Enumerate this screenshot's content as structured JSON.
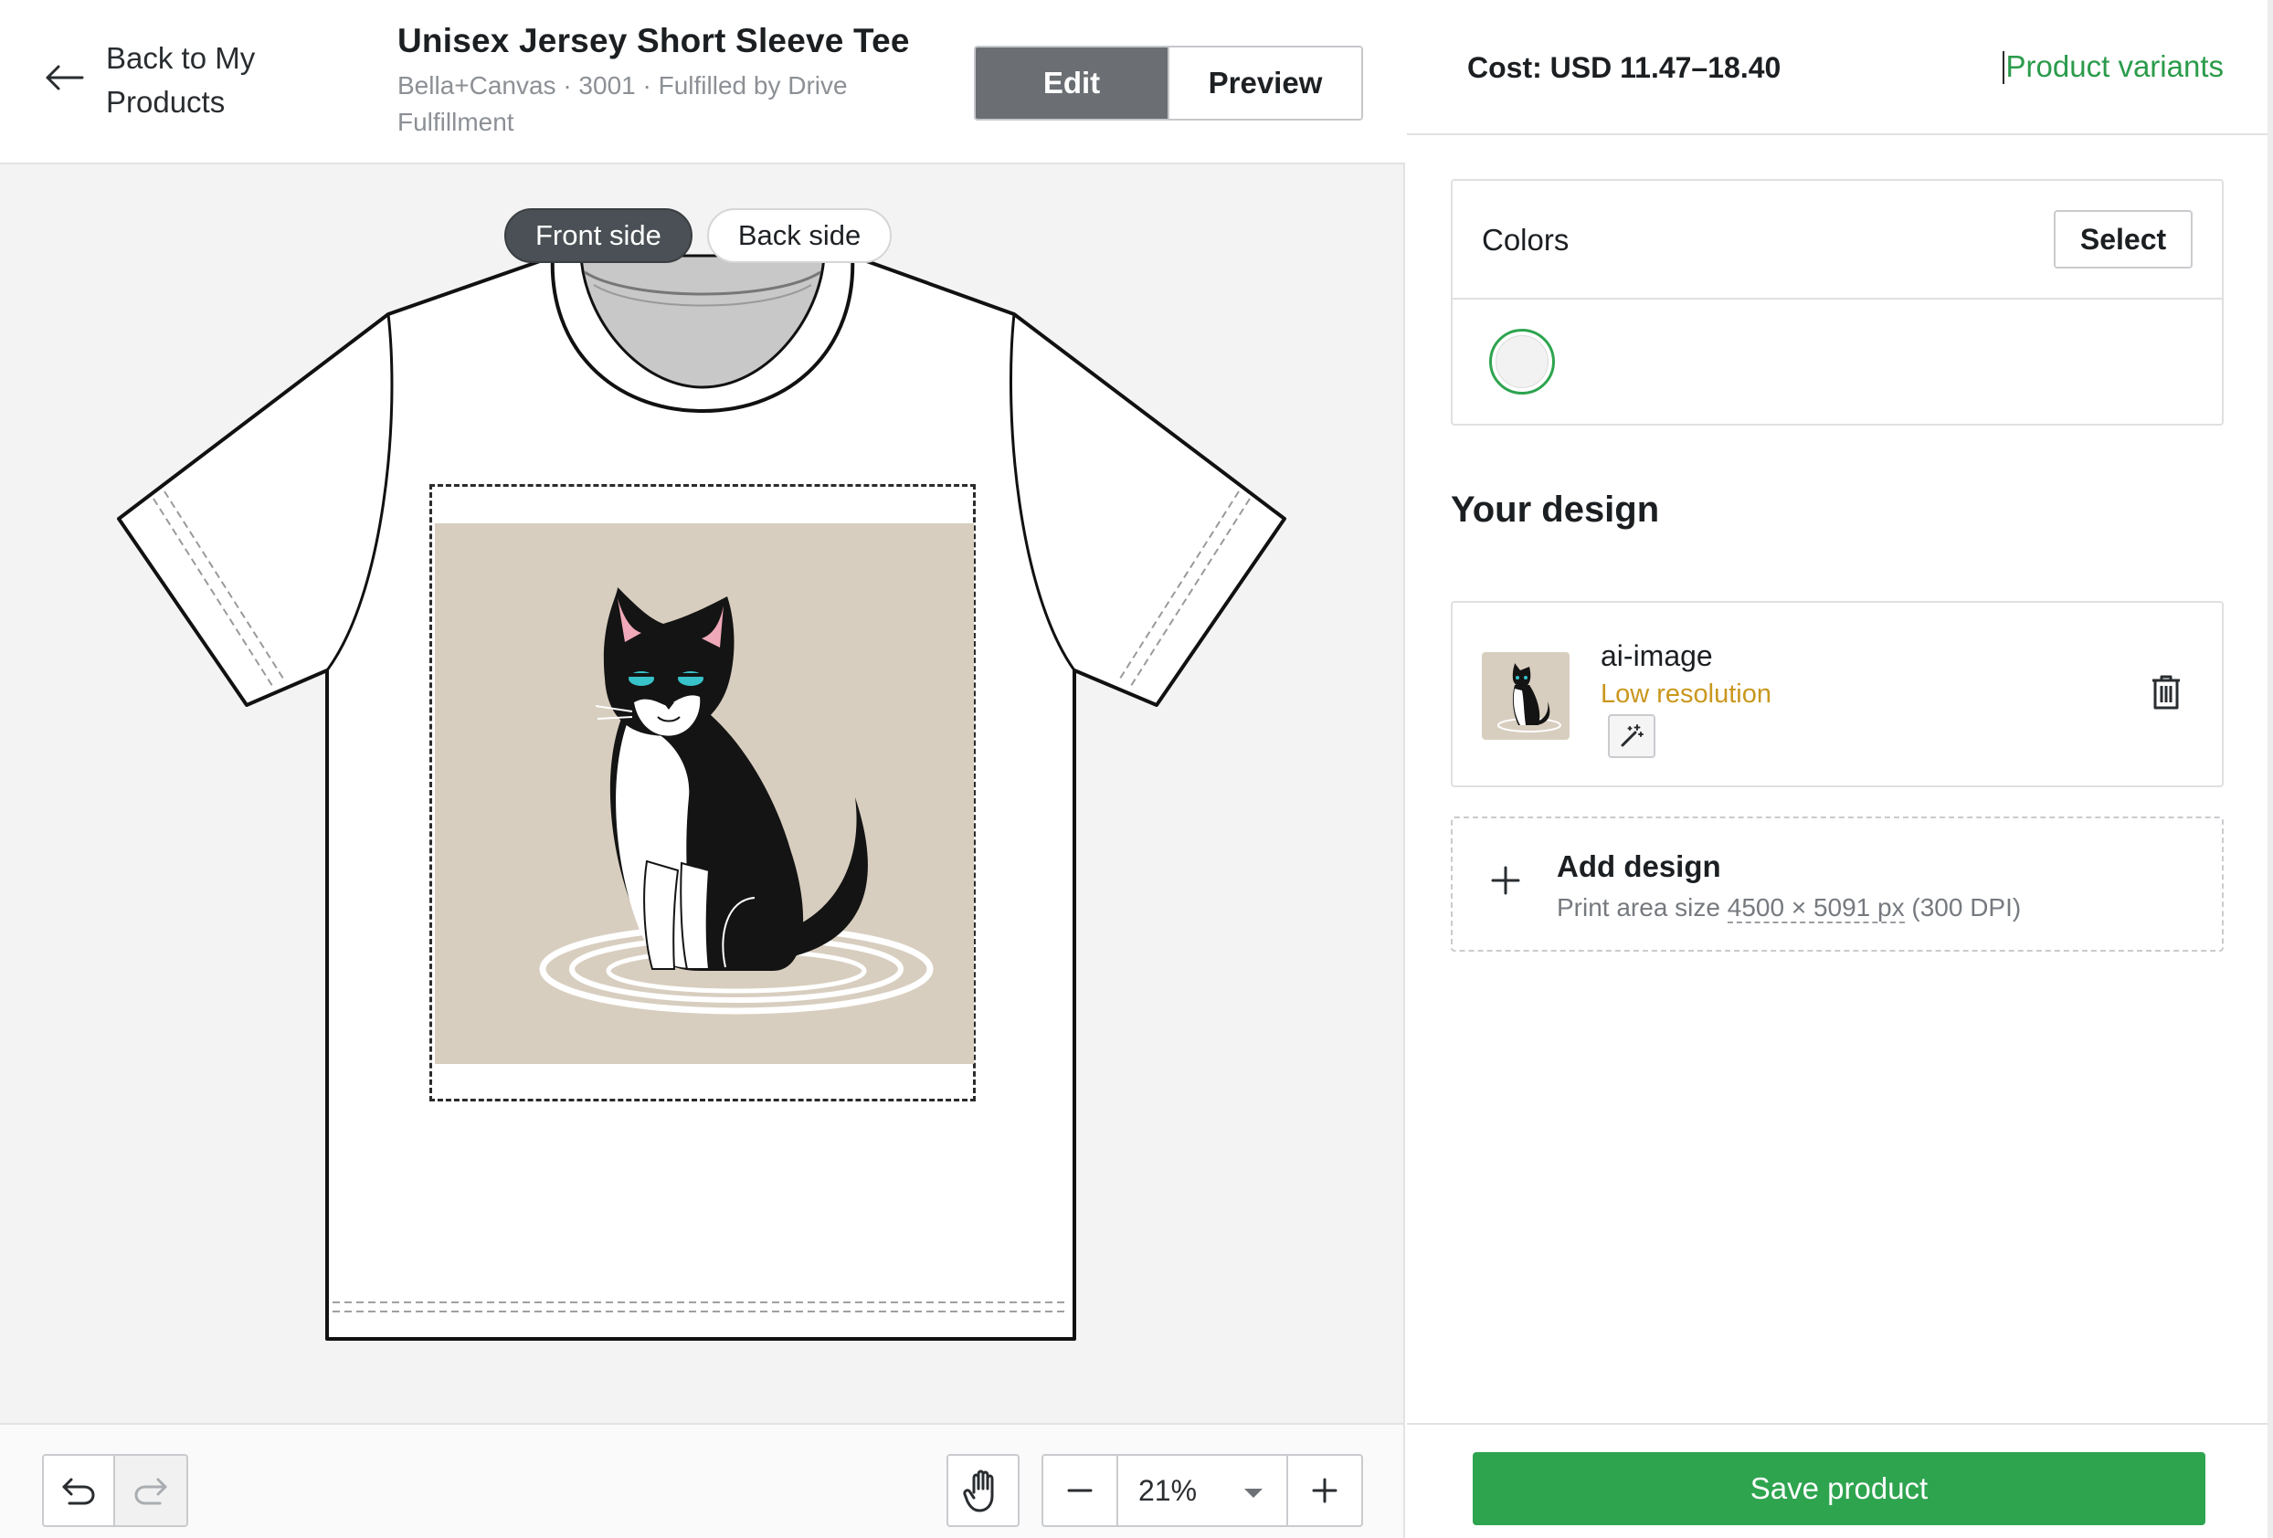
{
  "header": {
    "back_label": "Back to My Products",
    "title": "Unisex Jersey Short Sleeve Tee",
    "subtitle": "Bella+Canvas · 3001 · Fulfilled by Drive Fulfillment",
    "mode_edit": "Edit",
    "mode_preview": "Preview"
  },
  "canvas": {
    "front_side": "Front side",
    "back_side": "Back side",
    "zoom": "21%"
  },
  "panel": {
    "cost": "Cost: USD 11.47–18.40",
    "variants_link": "Product variants",
    "colors_label": "Colors",
    "select_label": "Select",
    "selected_color": "#f2f2f2",
    "your_design": "Your design",
    "design_name": "ai-image",
    "design_warning": "Low resolution",
    "add_design": "Add design",
    "print_area_prefix": "Print area size ",
    "print_area_size": "4500 × 5091 px",
    "print_area_dpi": " (300 DPI)",
    "save_label": "Save product"
  },
  "colors": {
    "accent": "#2ea44f",
    "warning": "#c9971d",
    "art_background": "#d8cebf"
  }
}
